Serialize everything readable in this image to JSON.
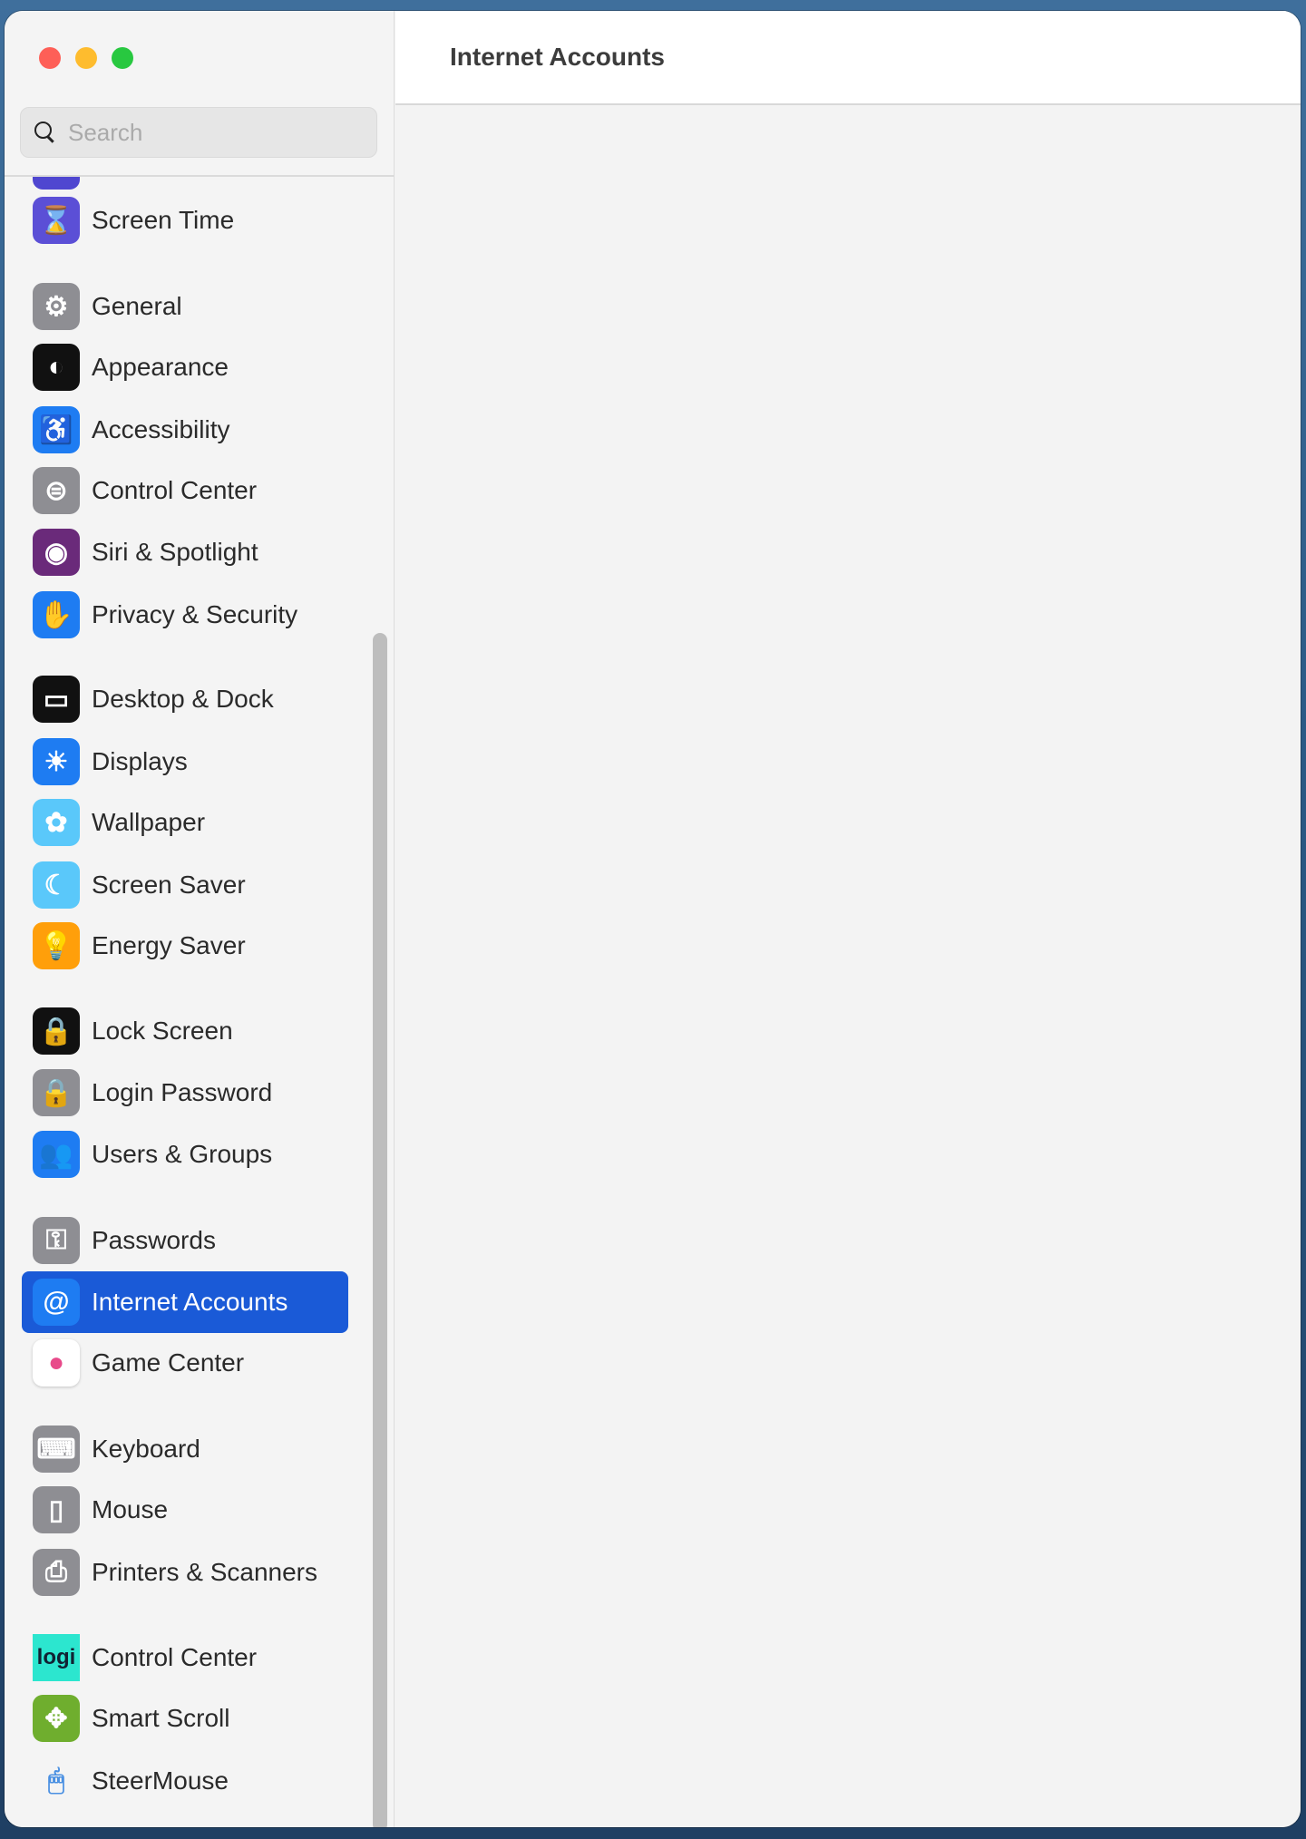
{
  "window": {
    "title": "Internet Accounts"
  },
  "search": {
    "placeholder": "Search"
  },
  "accent": "#1a5ad7",
  "sidebar": {
    "items": [
      {
        "label": "Screen Time",
        "icon": "hourglass-icon",
        "color": "#5b4fd6",
        "glyph": "⌛"
      },
      {
        "label": "General",
        "icon": "gear-icon",
        "color": "#8e8e93",
        "glyph": "⚙"
      },
      {
        "label": "Appearance",
        "icon": "appearance-icon",
        "color": "#111111",
        "glyph": "◐"
      },
      {
        "label": "Accessibility",
        "icon": "accessibility-icon",
        "color": "#1e7cf2",
        "glyph": "♿"
      },
      {
        "label": "Control Center",
        "icon": "toggles-icon",
        "color": "#8e8e93",
        "glyph": "⊜"
      },
      {
        "label": "Siri & Spotlight",
        "icon": "siri-icon",
        "color": "#6a2a7a",
        "glyph": "◉"
      },
      {
        "label": "Privacy & Security",
        "icon": "hand-icon",
        "color": "#1e7cf2",
        "glyph": "✋"
      },
      {
        "label": "Desktop & Dock",
        "icon": "dock-icon",
        "color": "#111111",
        "glyph": "▭"
      },
      {
        "label": "Displays",
        "icon": "sun-icon",
        "color": "#1e7cf2",
        "glyph": "☀"
      },
      {
        "label": "Wallpaper",
        "icon": "flower-icon",
        "color": "#5ac8fa",
        "glyph": "✿"
      },
      {
        "label": "Screen Saver",
        "icon": "screensaver-icon",
        "color": "#5ac8fa",
        "glyph": "☾"
      },
      {
        "label": "Energy Saver",
        "icon": "bulb-icon",
        "color": "#ff9f0a",
        "glyph": "💡"
      },
      {
        "label": "Lock Screen",
        "icon": "lock-screen-icon",
        "color": "#111111",
        "glyph": "🔒"
      },
      {
        "label": "Login Password",
        "icon": "lock-icon",
        "color": "#8e8e93",
        "glyph": "🔒"
      },
      {
        "label": "Users & Groups",
        "icon": "users-icon",
        "color": "#1e7cf2",
        "glyph": "👥"
      },
      {
        "label": "Passwords",
        "icon": "key-icon",
        "color": "#8e8e93",
        "glyph": "⚿"
      },
      {
        "label": "Internet Accounts",
        "icon": "at-icon",
        "color": "#1e7cf2",
        "glyph": "@",
        "selected": true
      },
      {
        "label": "Game Center",
        "icon": "game-center-icon",
        "color": "#ffffff",
        "glyph": "●"
      },
      {
        "label": "Keyboard",
        "icon": "keyboard-icon",
        "color": "#8e8e93",
        "glyph": "⌨"
      },
      {
        "label": "Mouse",
        "icon": "mouse-icon",
        "color": "#8e8e93",
        "glyph": "▯"
      },
      {
        "label": "Printers & Scanners",
        "icon": "printer-icon",
        "color": "#8e8e93",
        "glyph": "⎙"
      },
      {
        "label": "Control Center",
        "icon": "logi-icon",
        "color": "#2ce6cf",
        "glyph": "logi"
      },
      {
        "label": "Smart Scroll",
        "icon": "smart-scroll-icon",
        "color": "#6fae2e",
        "glyph": "✥"
      },
      {
        "label": "SteerMouse",
        "icon": "steermouse-icon",
        "color": "#f4f4f4",
        "glyph": "🖱"
      }
    ]
  }
}
